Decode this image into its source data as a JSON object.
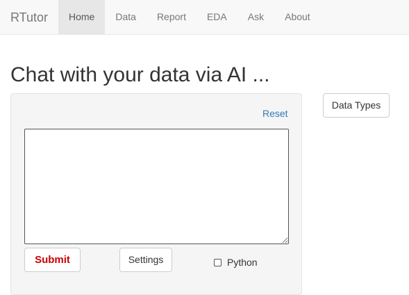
{
  "navbar": {
    "brand": "RTutor",
    "tabs": [
      {
        "label": "Home",
        "active": true
      },
      {
        "label": "Data",
        "active": false
      },
      {
        "label": "Report",
        "active": false
      },
      {
        "label": "EDA",
        "active": false
      },
      {
        "label": "Ask",
        "active": false
      },
      {
        "label": "About",
        "active": false
      }
    ]
  },
  "main": {
    "title": "Chat with your data via AI ...",
    "reset_label": "Reset",
    "prompt_value": "",
    "submit_label": "Submit",
    "settings_label": "Settings",
    "python_label": "Python",
    "python_checked": false,
    "data_types_label": "Data Types"
  },
  "colors": {
    "link": "#337ab7",
    "submit_text": "#cc0000",
    "navbar_bg": "#f8f8f8",
    "active_tab_bg": "#e7e7e7"
  }
}
